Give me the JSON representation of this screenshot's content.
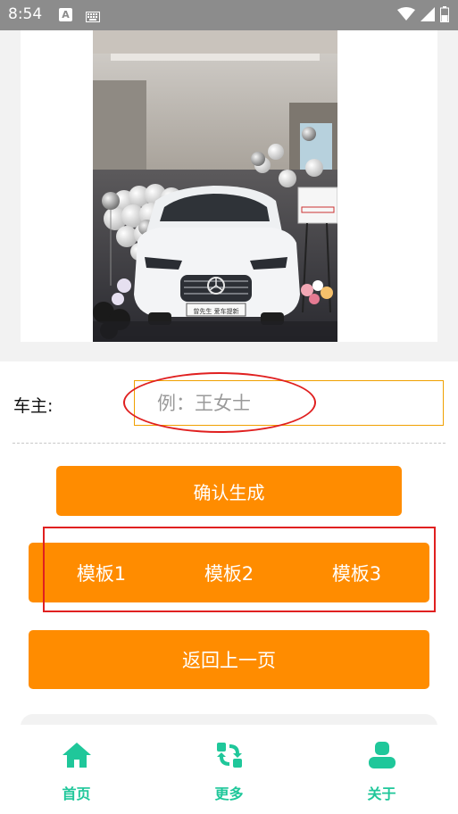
{
  "status_bar": {
    "time": "8:54",
    "icons": [
      "a-notification-icon",
      "keyboard-icon",
      "wifi-icon",
      "signal-icon",
      "battery-icon"
    ]
  },
  "photo": {
    "icon": "car-photo",
    "plate_text": "曾先生 爱车提新"
  },
  "form": {
    "owner_label": "车主:",
    "owner_placeholder": "例：王女士",
    "owner_value": ""
  },
  "buttons": {
    "confirm_label": "确认生成",
    "back_label": "返回上一页"
  },
  "templates": [
    {
      "label": "模板1"
    },
    {
      "label": "模板2"
    },
    {
      "label": "模板3"
    }
  ],
  "nav": [
    {
      "label": "首页",
      "icon": "home-icon"
    },
    {
      "label": "更多",
      "icon": "refresh-icon"
    },
    {
      "label": "关于",
      "icon": "user-icon"
    }
  ],
  "colors": {
    "accent": "#ff8c00",
    "nav_active": "#1fc79a",
    "annotation": "#e02020",
    "input_border": "#f0a000"
  }
}
